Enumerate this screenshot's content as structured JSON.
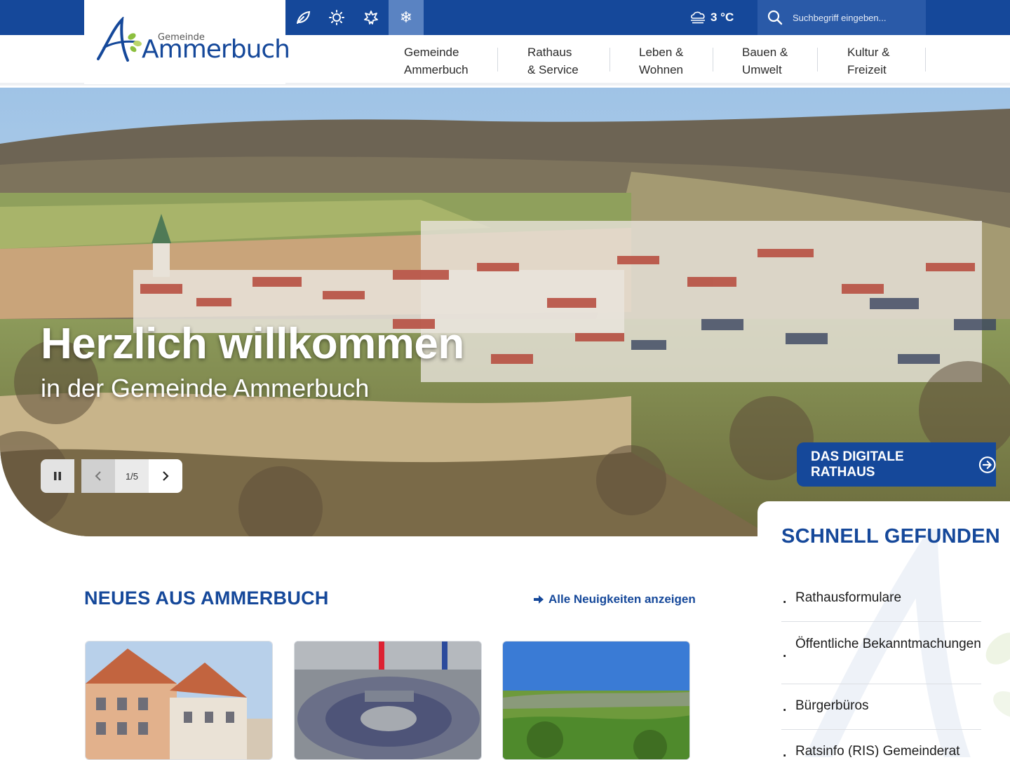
{
  "logo": {
    "small": "Gemeinde",
    "big": "Ammerbuch"
  },
  "seasons": [
    {
      "name": "spring-icon",
      "glyph": "❧"
    },
    {
      "name": "summer-icon",
      "glyph": "✹"
    },
    {
      "name": "autumn-icon",
      "glyph": "❀"
    },
    {
      "name": "winter-icon",
      "glyph": "❄"
    }
  ],
  "weather": {
    "temp": "3 °C",
    "icon": "cloud-fog-icon"
  },
  "search": {
    "placeholder": "Suchbegriff eingeben..."
  },
  "nav": [
    {
      "line1": "Gemeinde",
      "line2": "Ammerbuch"
    },
    {
      "line1": "Rathaus",
      "line2": "& Service"
    },
    {
      "line1": "Leben &",
      "line2": "Wohnen"
    },
    {
      "line1": "Bauen &",
      "line2": "Umwelt"
    },
    {
      "line1": "Kultur &",
      "line2": "Freizeit"
    }
  ],
  "hero": {
    "title": "Herzlich willkommen",
    "subtitle": "in der Gemeinde Ammerbuch",
    "counter": "1/5"
  },
  "digital_button": "DAS DIGITALE RATHAUS",
  "quick": {
    "title": "SCHNELL GEFUNDEN",
    "items": [
      "Rathausformulare",
      "Öffentliche Bekanntmachungen",
      "Bürgerbüros",
      "Ratsinfo (RIS) Gemeinderat"
    ]
  },
  "news": {
    "title": "NEUES AUS AMMERBUCH",
    "link": "Alle Neuigkeiten anzeigen"
  },
  "colors": {
    "brand": "#15489a",
    "brand_light": "#5a83c2",
    "leaf_green": "#8cbf3f"
  }
}
